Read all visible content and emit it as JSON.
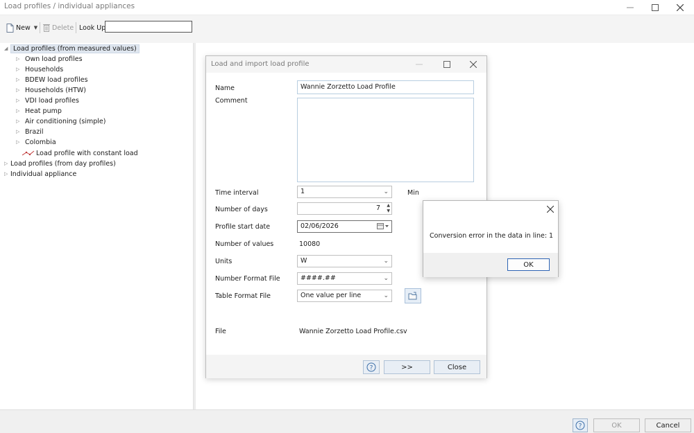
{
  "window": {
    "title": "Load profiles / individual appliances"
  },
  "toolbar": {
    "new_label": "New",
    "delete_label": "Delete",
    "lookup_label": "Look Up",
    "lookup_value": ""
  },
  "tree": {
    "root_measured": "Load profiles (from measured values)",
    "children": [
      "Own load profiles",
      "Households",
      "BDEW load profiles",
      "Households (HTW)",
      "VDI load profiles",
      "Heat pump",
      "Air conditioning (simple)",
      "Brazil",
      "Colombia"
    ],
    "constant_load": "Load profile with constant load",
    "root_day": "Load profiles (from day profiles)",
    "root_appliance": "Individual appliance"
  },
  "dialog": {
    "title": "Load and import load profile",
    "name_label": "Name",
    "name_value": "Wannie Zorzetto Load Profile",
    "comment_label": "Comment",
    "comment_value": "",
    "time_interval_label": "Time interval",
    "time_interval_value": "1",
    "time_interval_unit": "Min",
    "days_label": "Number of days",
    "days_value": "7",
    "start_date_label": "Profile start date",
    "start_date_value": "02/06/2026",
    "num_values_label": "Number of values",
    "num_values_value": "10080",
    "units_label": "Units",
    "units_value": "W",
    "number_format_label": "Number Format File",
    "number_format_value": "####.##",
    "table_format_label": "Table Format File",
    "table_format_value": "One value per line",
    "file_label": "File",
    "file_value": "Wannie Zorzetto Load Profile.csv",
    "next_label": ">>",
    "close_label": "Close"
  },
  "message": {
    "text": "Conversion error in the data in line: 1",
    "ok_label": "OK"
  },
  "footer": {
    "ok_label": "OK",
    "cancel_label": "Cancel"
  }
}
